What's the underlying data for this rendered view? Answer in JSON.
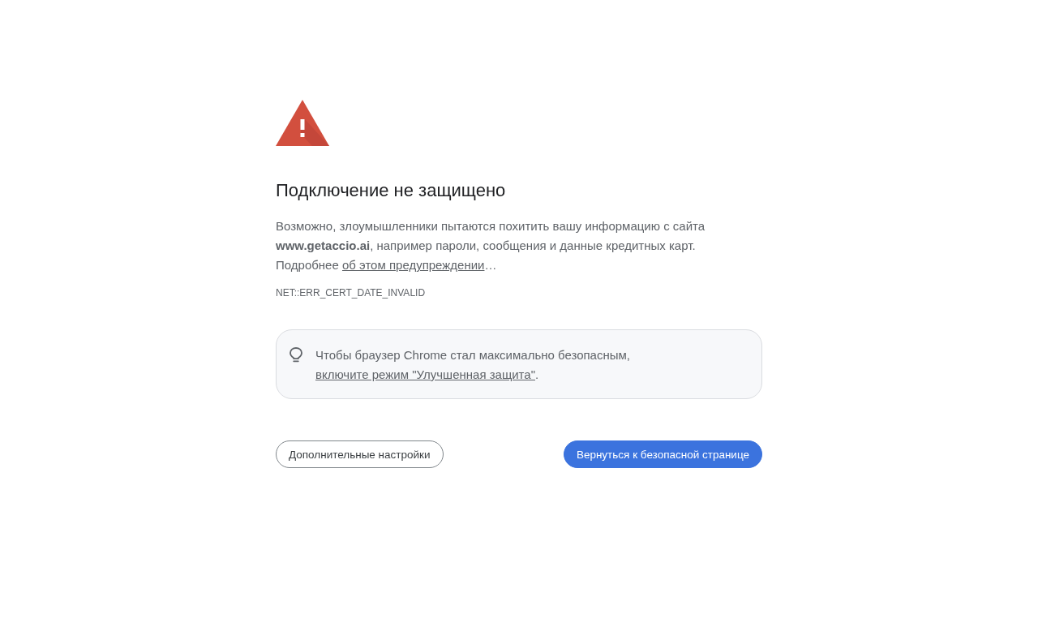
{
  "heading": "Подключение не защищено",
  "explanation": "Возможно, злоумышленники пытаются похитить вашу информацию с сайта **www.getaccio.ai**, например пароли, сообщения и данные кредитных карт.",
  "learn_more": {
    "prefix": "Подробнее",
    "link": "об этом предупреждении",
    "suffix": "…"
  },
  "error_code": "NET::ERR_CERT_DATE_INVALID",
  "tip": {
    "text": "Чтобы браузер Chrome стал максимально безопасным,",
    "link": "включите режим \"Улучшенная защита\"",
    "suffix": "."
  },
  "buttons": [
    {
      "label": "Дополнительные настройки",
      "kind": "secondary"
    },
    {
      "label": "Вернуться к безопасной странице",
      "kind": "primary"
    }
  ]
}
